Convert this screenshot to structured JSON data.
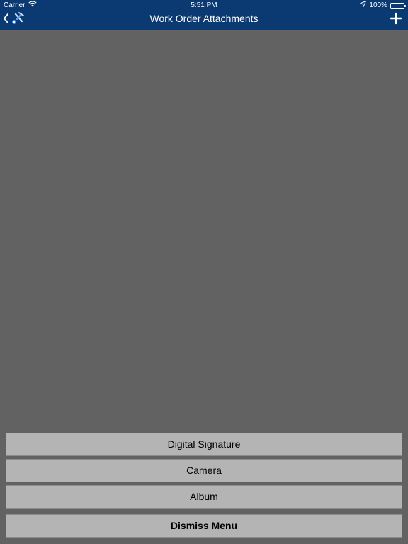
{
  "status_bar": {
    "carrier": "Carrier",
    "time": "5:51 PM",
    "battery": "100%",
    "icons": [
      "wifi-icon",
      "location-arrow-icon",
      "battery-icon"
    ]
  },
  "nav": {
    "title": "Work Order Attachments",
    "back_icon": "chevron-left-icon",
    "app_icon": "app-logo-icon",
    "add_icon": "plus-icon"
  },
  "menu": {
    "items": [
      "Digital Signature",
      "Camera",
      "Album"
    ],
    "dismiss_label": "Dismiss Menu"
  },
  "colors": {
    "nav_background": "#0b3a73",
    "content_background": "#626262",
    "menu_button_background": "#b4b4b4"
  }
}
